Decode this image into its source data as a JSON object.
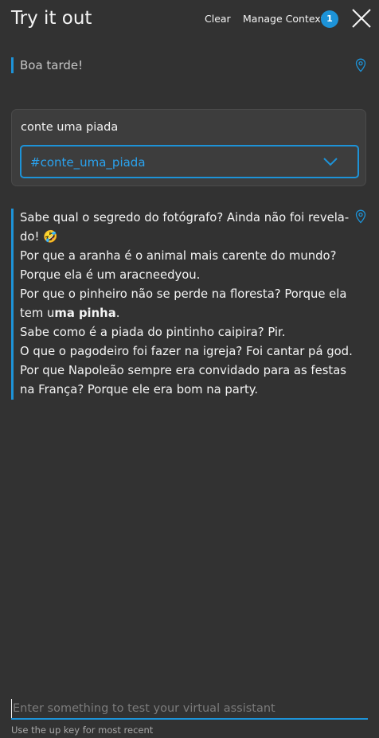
{
  "header": {
    "title": "Try it out",
    "clear_label": "Clear",
    "manage_context_label": "Manage Context",
    "context_count": "1"
  },
  "conversation": {
    "greeting": "Boa tarde!",
    "option_card": {
      "label": "conte uma piada",
      "selected_value": "#conte_uma_piada"
    },
    "answer_lines": [
      "Sabe qual o segredo do fotógrafo? Ainda não foi revela-",
      "do! 🤣",
      "Por que a aranha é o animal mais carente do mundo?",
      "Porque ela é um aracneedyou.",
      "Por que o pinheiro não se perde na floresta? Porque ela",
      "tem u",
      "ma pinha",
      ".",
      "Sabe como é a piada do pintinho caipira? Pir.",
      "O que o pagodeiro foi fazer na igreja? Foi cantar pá god.",
      "Por que Napoleão sempre era convidado para as festas",
      "na França? Porque ele era bom na party."
    ]
  },
  "input": {
    "placeholder": "Enter something to test your virtual assistant",
    "hint": "Use the up key for most recent"
  },
  "icons": {
    "close": "close-icon",
    "pin": "location-pin-icon",
    "chevron": "chevron-down-icon"
  },
  "colors": {
    "background": "#323232",
    "accent": "#1d93d8",
    "card": "#3d3d3d",
    "text": "#f4f4f4",
    "muted": "#c6c6c6"
  }
}
